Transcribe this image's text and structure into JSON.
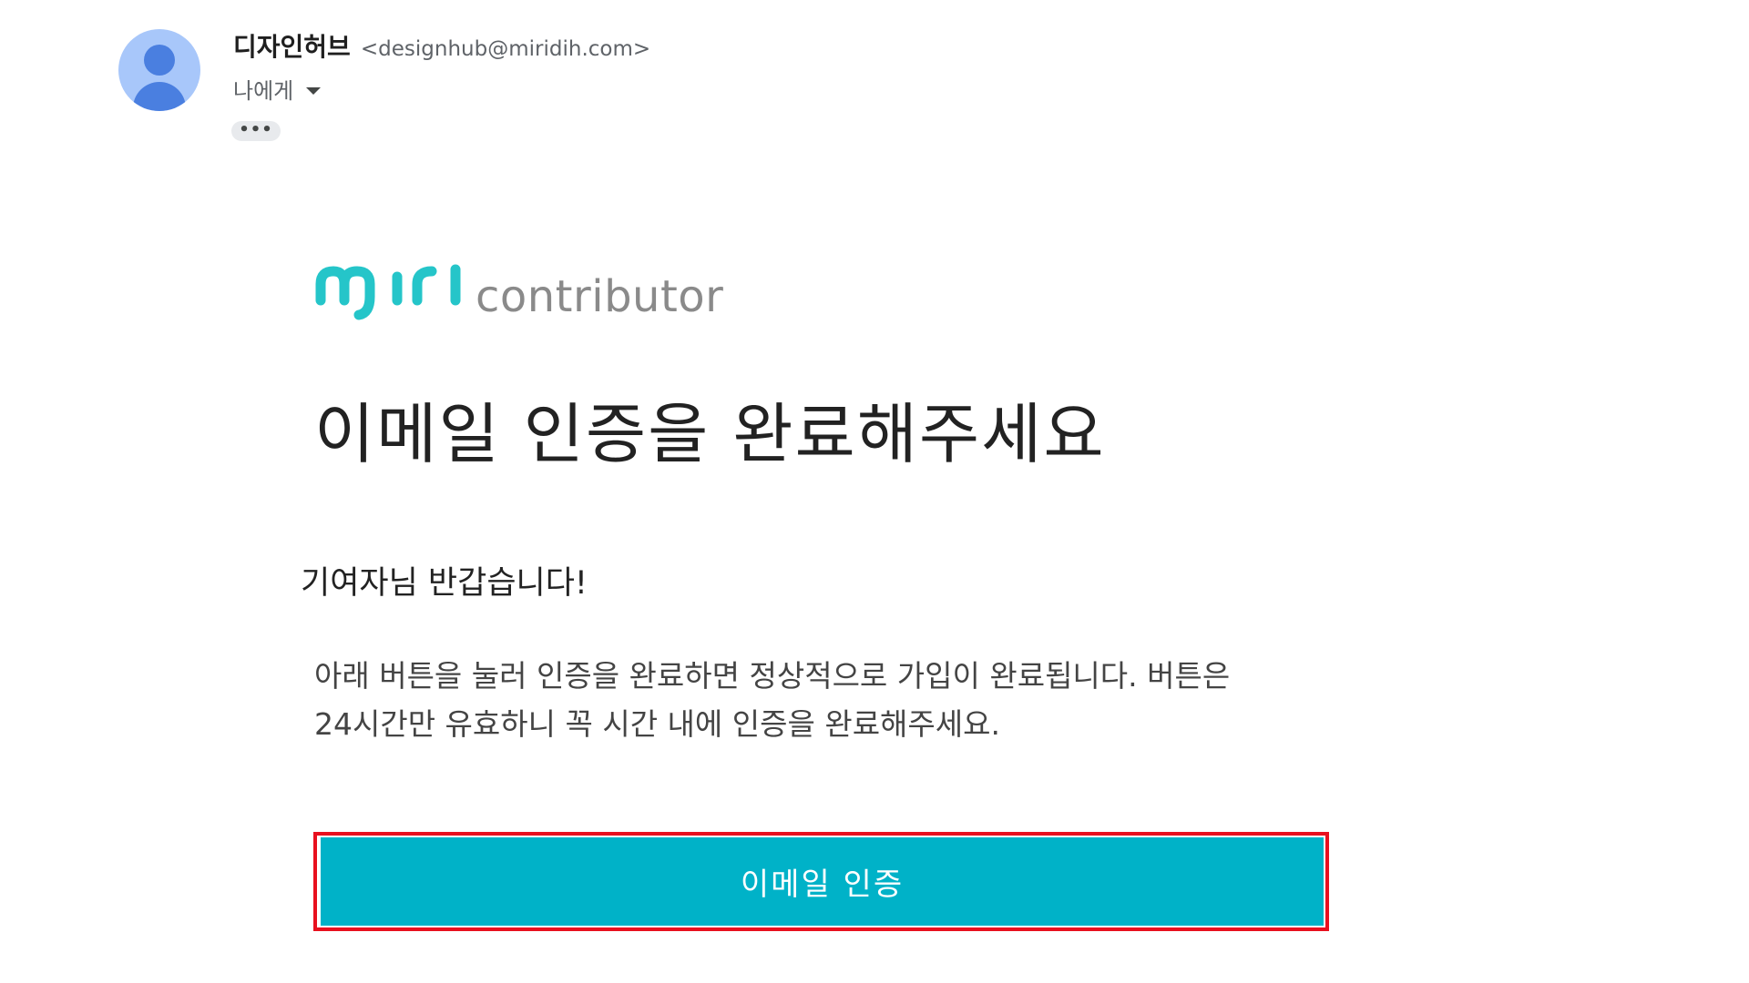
{
  "sender": {
    "name": "디자인허브",
    "email": "<designhub@miridih.com>",
    "avatar_icon": "person-avatar-icon"
  },
  "recipient": {
    "label": "나에게",
    "dropdown_icon": "caret-down-icon"
  },
  "more_button": {
    "label": "•••"
  },
  "logo": {
    "wordmark": "miri",
    "subtext": "contributor",
    "wordmark_color": "#25c5c9",
    "subtext_color": "#8a8a8a"
  },
  "headline": "이메일 인증을 완료해주세요",
  "greeting": "기여자님 반갑습니다!",
  "body": {
    "line1": "아래 버튼을 눌러 인증을 완료하면 정상적으로 가입이 완료됩니다. 버튼은",
    "line2": "24시간만 유효하니 꼭 시간 내에 인증을 완료해주세요."
  },
  "verify_button": {
    "label": "이메일 인증",
    "background": "#00b2c8",
    "highlight_color": "#e8101e"
  }
}
